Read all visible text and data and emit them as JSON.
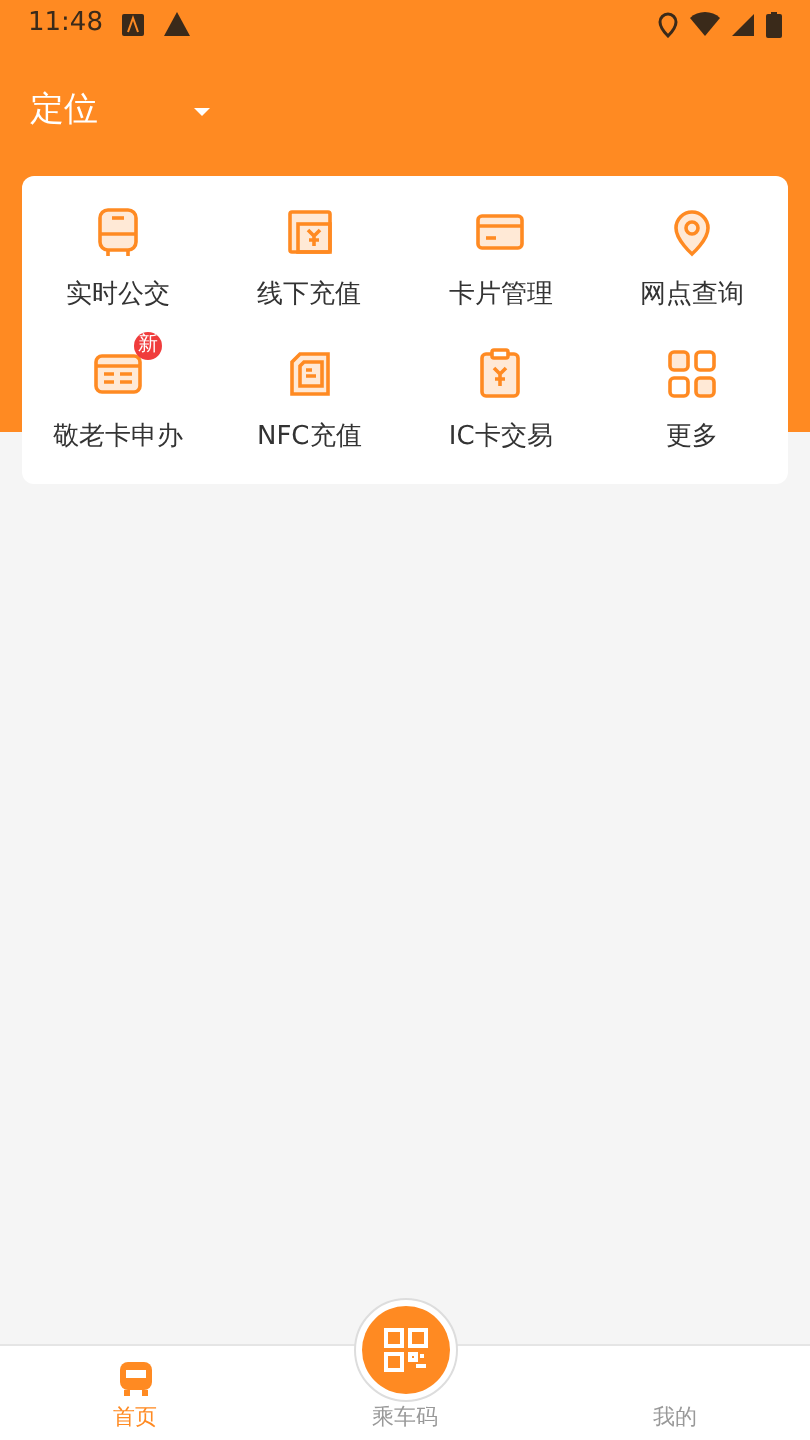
{
  "status_bar": {
    "time": "11:48"
  },
  "header": {
    "location": "定位"
  },
  "services": [
    {
      "label": "实时公交",
      "kind": "bus"
    },
    {
      "label": "线下充值",
      "kind": "recharge"
    },
    {
      "label": "卡片管理",
      "kind": "card"
    },
    {
      "label": "网点查询",
      "kind": "pin"
    },
    {
      "label": "敬老卡申办",
      "kind": "senior",
      "badge": "新"
    },
    {
      "label": "NFC充值",
      "kind": "nfc"
    },
    {
      "label": "IC卡交易",
      "kind": "ic"
    },
    {
      "label": "更多",
      "kind": "grid"
    }
  ],
  "tabs": [
    {
      "label": "首页",
      "kind": "bus",
      "selected": true
    },
    {
      "label": "乘车码",
      "kind": "qr",
      "selected": false
    },
    {
      "label": "我的",
      "kind": "none",
      "selected": false
    }
  ]
}
